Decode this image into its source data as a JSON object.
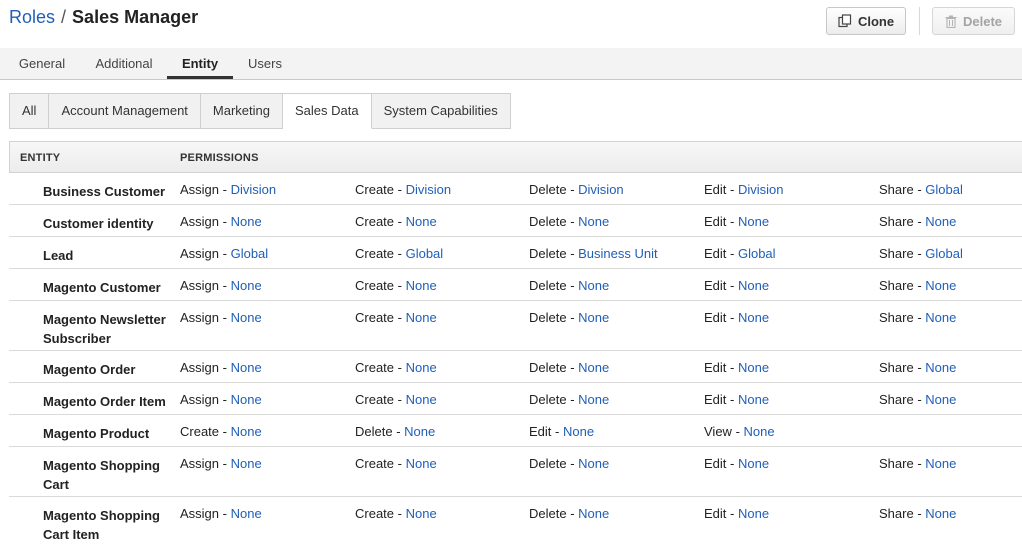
{
  "header": {
    "breadcrumb_link": "Roles",
    "separator": "/",
    "title": "Sales Manager",
    "clone_label": "Clone",
    "delete_label": "Delete"
  },
  "tabs": [
    {
      "label": "General"
    },
    {
      "label": "Additional"
    },
    {
      "label": "Entity",
      "active": true
    },
    {
      "label": "Users"
    }
  ],
  "subtabs": [
    {
      "label": "All"
    },
    {
      "label": "Account Management"
    },
    {
      "label": "Marketing"
    },
    {
      "label": "Sales Data",
      "active": true
    },
    {
      "label": "System Capabilities"
    }
  ],
  "grid": {
    "headers": {
      "entity": "ENTITY",
      "permissions": "PERMISSIONS"
    },
    "rows": [
      {
        "entity": "Business Customer",
        "perms": [
          [
            "Assign",
            "Division"
          ],
          [
            "Create",
            "Division"
          ],
          [
            "Delete",
            "Division"
          ],
          [
            "Edit",
            "Division"
          ],
          [
            "Share",
            "Global"
          ]
        ]
      },
      {
        "entity": "Customer identity",
        "perms": [
          [
            "Assign",
            "None"
          ],
          [
            "Create",
            "None"
          ],
          [
            "Delete",
            "None"
          ],
          [
            "Edit",
            "None"
          ],
          [
            "Share",
            "None"
          ]
        ]
      },
      {
        "entity": "Lead",
        "perms": [
          [
            "Assign",
            "Global"
          ],
          [
            "Create",
            "Global"
          ],
          [
            "Delete",
            "Business Unit"
          ],
          [
            "Edit",
            "Global"
          ],
          [
            "Share",
            "Global"
          ]
        ]
      },
      {
        "entity": "Magento Customer",
        "perms": [
          [
            "Assign",
            "None"
          ],
          [
            "Create",
            "None"
          ],
          [
            "Delete",
            "None"
          ],
          [
            "Edit",
            "None"
          ],
          [
            "Share",
            "None"
          ]
        ]
      },
      {
        "entity": "Magento Newsletter Subscriber",
        "perms": [
          [
            "Assign",
            "None"
          ],
          [
            "Create",
            "None"
          ],
          [
            "Delete",
            "None"
          ],
          [
            "Edit",
            "None"
          ],
          [
            "Share",
            "None"
          ]
        ]
      },
      {
        "entity": "Magento Order",
        "perms": [
          [
            "Assign",
            "None"
          ],
          [
            "Create",
            "None"
          ],
          [
            "Delete",
            "None"
          ],
          [
            "Edit",
            "None"
          ],
          [
            "Share",
            "None"
          ]
        ]
      },
      {
        "entity": "Magento Order Item",
        "perms": [
          [
            "Assign",
            "None"
          ],
          [
            "Create",
            "None"
          ],
          [
            "Delete",
            "None"
          ],
          [
            "Edit",
            "None"
          ],
          [
            "Share",
            "None"
          ]
        ]
      },
      {
        "entity": "Magento Product",
        "perms": [
          [
            "Create",
            "None"
          ],
          [
            "Delete",
            "None"
          ],
          [
            "Edit",
            "None"
          ],
          [
            "View",
            "None"
          ]
        ]
      },
      {
        "entity": "Magento Shopping Cart",
        "perms": [
          [
            "Assign",
            "None"
          ],
          [
            "Create",
            "None"
          ],
          [
            "Delete",
            "None"
          ],
          [
            "Edit",
            "None"
          ],
          [
            "Share",
            "None"
          ]
        ]
      },
      {
        "entity": "Magento Shopping Cart Item",
        "perms": [
          [
            "Assign",
            "None"
          ],
          [
            "Create",
            "None"
          ],
          [
            "Delete",
            "None"
          ],
          [
            "Edit",
            "None"
          ],
          [
            "Share",
            "None"
          ]
        ]
      }
    ]
  },
  "colors": {
    "link": "#1f5fb8",
    "active_tab_border": "#333333"
  }
}
